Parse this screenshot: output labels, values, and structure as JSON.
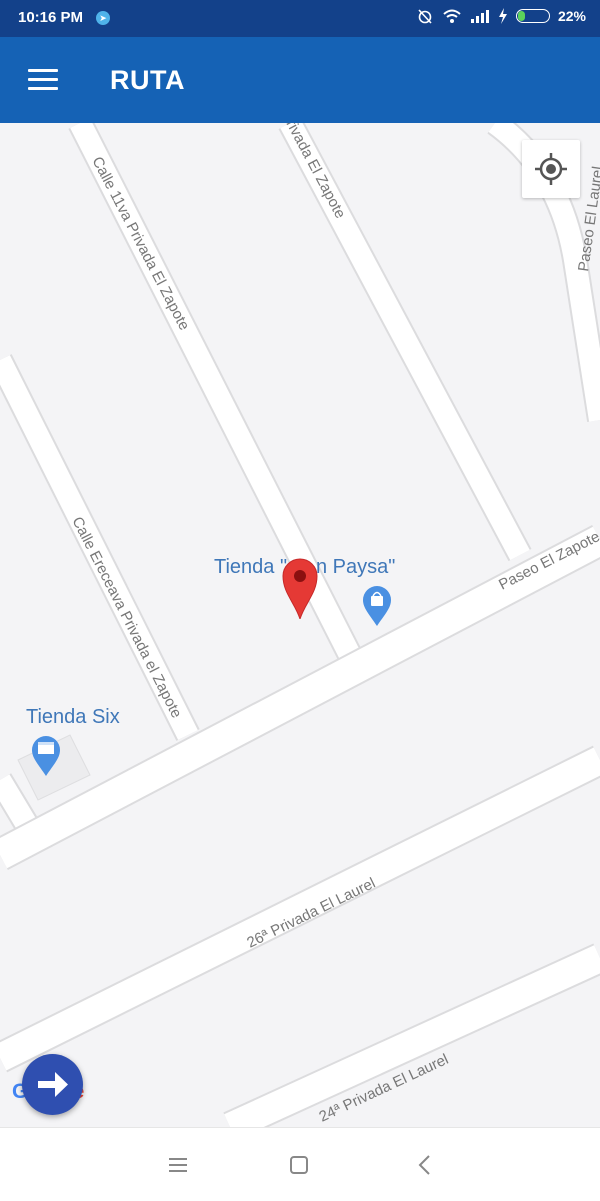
{
  "status_bar": {
    "time": "10:16 PM",
    "battery": "22%",
    "battery_level": 0.22,
    "icons": [
      "telegram-icon",
      "alarm-off-icon",
      "wifi-icon",
      "signal-icon",
      "charging-icon",
      "battery-icon"
    ]
  },
  "app_bar": {
    "title": "RUTA",
    "menu_icon": "hamburger-menu-icon"
  },
  "map": {
    "streets": [
      "Calle 11va Privada El Zapote",
      "rivada El Zapote",
      "Paseo El Laurel",
      "Calle Ereceava Privada el Zapote",
      "Paseo El Zapote",
      "26ª Privada El Laurel",
      "24ª Privada El Laurel"
    ],
    "places": {
      "store_main": "Tienda \"Don Paysa\"",
      "store_main_visible": [
        "Tienda \"",
        "n Paysa\""
      ],
      "store_six": "Tienda Six"
    },
    "attribution": [
      "G",
      "oo",
      "gl",
      "e"
    ],
    "colors": {
      "map_bg": "#f4f4f6",
      "road": "#ffffff",
      "road_edge": "#dcdcde",
      "poi_text": "#3f77b8",
      "marker": "#e53935",
      "poi_pin": "#4a90e2"
    }
  },
  "controls": {
    "my_location_icon": "my-location-icon",
    "fab_icon": "arrow-right-icon"
  },
  "nav_bar": {
    "icons": [
      "menu-icon",
      "home-square-icon",
      "back-chevron-icon"
    ]
  }
}
